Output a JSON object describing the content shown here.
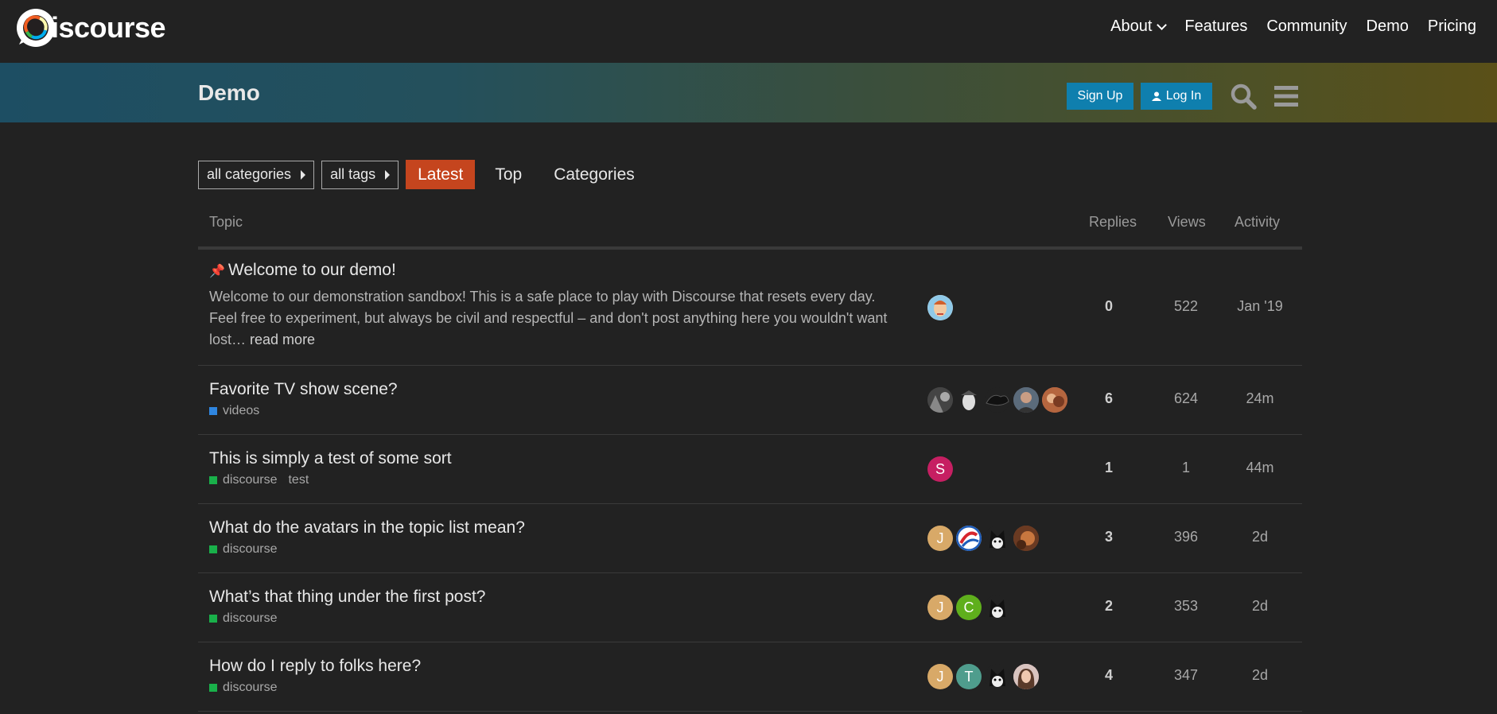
{
  "site": {
    "logo_text": "iscourse",
    "links": [
      {
        "label": "About",
        "dropdown": true
      },
      {
        "label": "Features"
      },
      {
        "label": "Community"
      },
      {
        "label": "Demo"
      },
      {
        "label": "Pricing"
      }
    ]
  },
  "header": {
    "title": "Demo",
    "signup_label": "Sign Up",
    "login_label": "Log In",
    "search_icon": "search-icon",
    "menu_icon": "hamburger-icon"
  },
  "nav": {
    "categories_dropdown": "all categories",
    "tags_dropdown": "all tags",
    "tabs": [
      {
        "label": "Latest",
        "active": true
      },
      {
        "label": "Top",
        "active": false
      },
      {
        "label": "Categories",
        "active": false
      }
    ]
  },
  "columns": {
    "topic": "Topic",
    "replies": "Replies",
    "views": "Views",
    "activity": "Activity"
  },
  "topics": [
    {
      "title": "Welcome to our demo!",
      "pinned": true,
      "excerpt": "Welcome to our demonstration sandbox! This is a safe place to play with Discourse that resets every day. Feel free to experiment, but always be civil and respectful – and don't post anything here you wouldn't want lost…",
      "read_more": "read more",
      "replies": "0",
      "views": "522",
      "activity": "Jan '19"
    },
    {
      "title": "Favorite TV show scene?",
      "category": "videos",
      "category_color": "#2f86e0",
      "replies": "6",
      "views": "624",
      "activity": "24m"
    },
    {
      "title": "This is simply a test of some sort",
      "category": "discourse",
      "category_color": "#19b04a",
      "tag": "test",
      "avatar_letter": "S",
      "replies": "1",
      "views": "1",
      "activity": "44m"
    },
    {
      "title": "What do the avatars in the topic list mean?",
      "category": "discourse",
      "category_color": "#19b04a",
      "avatar_letter": "J",
      "replies": "3",
      "views": "396",
      "activity": "2d"
    },
    {
      "title": "What’s that thing under the first post?",
      "category": "discourse",
      "category_color": "#19b04a",
      "avatar_letters": [
        "J",
        "C"
      ],
      "replies": "2",
      "views": "353",
      "activity": "2d"
    },
    {
      "title": "How do I reply to folks here?",
      "category": "discourse",
      "category_color": "#19b04a",
      "avatar_letters": [
        "J",
        "T"
      ],
      "replies": "4",
      "views": "347",
      "activity": "2d"
    }
  ]
}
